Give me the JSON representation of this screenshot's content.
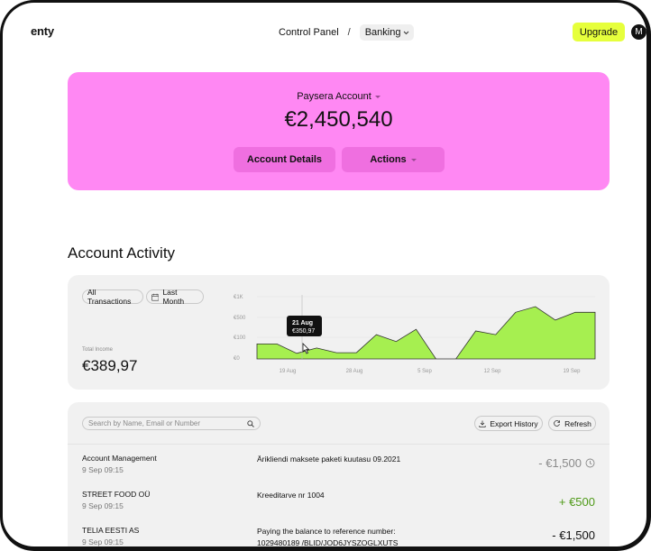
{
  "header": {
    "logo": "enty",
    "breadcrumb": {
      "root": "Control Panel",
      "separator": "/",
      "current": "Banking"
    },
    "upgrade_label": "Upgrade",
    "avatar_initial": "M"
  },
  "balance_card": {
    "account_name": "Paysera Account",
    "balance": "€2,450,540",
    "details_label": "Account Details",
    "actions_label": "Actions",
    "color": "#ff88f3"
  },
  "activity": {
    "title": "Account Activity",
    "filter_all": "All Transactions",
    "filter_period": "Last Month",
    "income_label": "Total Income",
    "income_value": "€389,97",
    "tooltip": {
      "date": "21 Aug",
      "value": "€350,97"
    }
  },
  "chart_data": {
    "type": "area",
    "y_ticks": [
      "€1K",
      "€500",
      "€100",
      "€0"
    ],
    "x_ticks": [
      "19 Aug",
      "28 Aug",
      "5 Sep",
      "12 Sep",
      "19 Sep"
    ],
    "series": [
      {
        "values": [
          0.48,
          0.48,
          0.18,
          0.35,
          0.2,
          0.2,
          0.78,
          0.56,
          0.95,
          0.0,
          0.0,
          0.9,
          0.78,
          1.5,
          1.68,
          1.25,
          1.5,
          1.5
        ]
      }
    ],
    "fill_color": "#a6ef50"
  },
  "transactions": {
    "search_placeholder": "Search by Name, Email or Number",
    "export_label": "Export History",
    "refresh_label": "Refresh",
    "rows": [
      {
        "name": "Account Management",
        "time": "9 Sep 09:15",
        "desc1": "Ärikliendi maksete paketi kuutasu 09.2021",
        "desc2": "",
        "amount": "- €1,500"
      },
      {
        "name": "STREET FOOD OÜ",
        "time": "9 Sep 09:15",
        "desc1": "Kreeditarve nr 1004",
        "desc2": "",
        "amount": "+ €500"
      },
      {
        "name": "TELIA EESTI AS",
        "time": "9 Sep 09:15",
        "desc1": "Paying the balance to reference number:",
        "desc2": "1029480189 /BLID/JOD6JYSZOGLXUTS",
        "amount": "- €1,500"
      }
    ]
  }
}
